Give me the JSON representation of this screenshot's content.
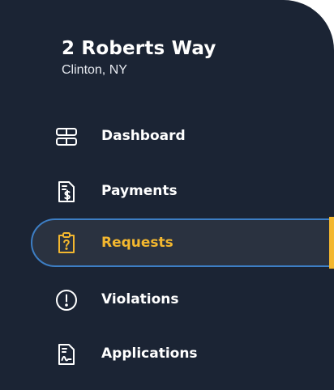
{
  "property": {
    "street": "2 Roberts Way",
    "city": "Clinton, NY"
  },
  "nav": {
    "items": [
      {
        "label": "Dashboard",
        "icon": "dashboard-icon",
        "active": false
      },
      {
        "label": "Payments",
        "icon": "payments-document-icon",
        "active": false
      },
      {
        "label": "Requests",
        "icon": "requests-clipboard-icon",
        "active": true
      },
      {
        "label": "Violations",
        "icon": "violations-exclamation-icon",
        "active": false
      },
      {
        "label": "Applications",
        "icon": "applications-document-icon",
        "active": false
      }
    ]
  },
  "colors": {
    "sidebar_background": "#1b2434",
    "active_background": "#2a3240",
    "active_border": "#3d7ec4",
    "active_accent": "#f3b72f",
    "text": "#ffffff"
  }
}
